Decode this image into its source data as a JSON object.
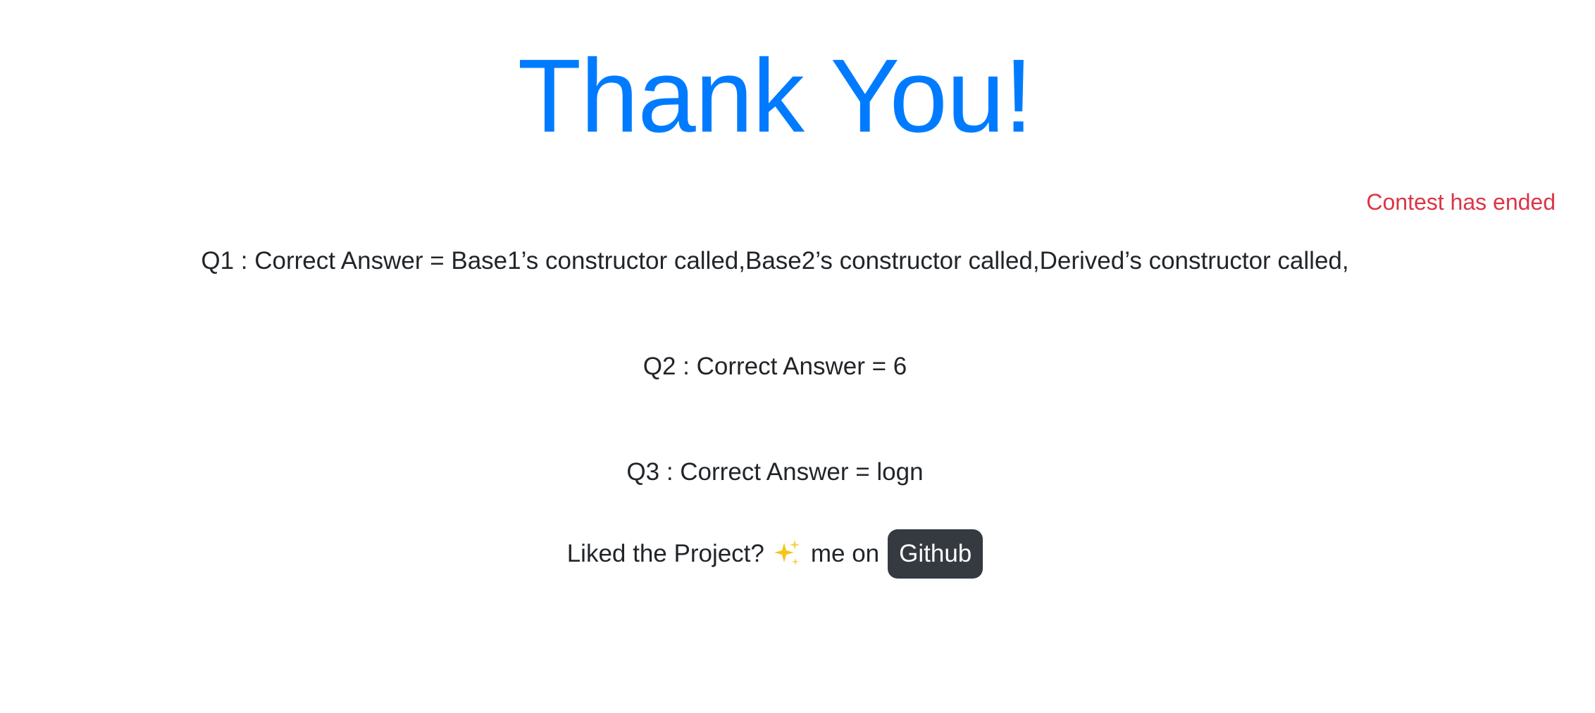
{
  "heading": "Thank You!",
  "status_text": "Contest has ended",
  "answers": [
    "Q1 : Correct Answer = Base1’s constructor called,Base2’s constructor called,Derived’s constructor called,",
    "Q2 : Correct Answer = 6",
    "Q3 : Correct Answer = logn"
  ],
  "footer": {
    "prefix": "Liked the Project?",
    "icon": "sparkles-icon",
    "suffix": "me on",
    "button_label": "Github"
  },
  "colors": {
    "heading": "#007bff",
    "status": "#dc3545",
    "text": "#212529",
    "button_bg": "#343a40",
    "button_text": "#ffffff"
  }
}
